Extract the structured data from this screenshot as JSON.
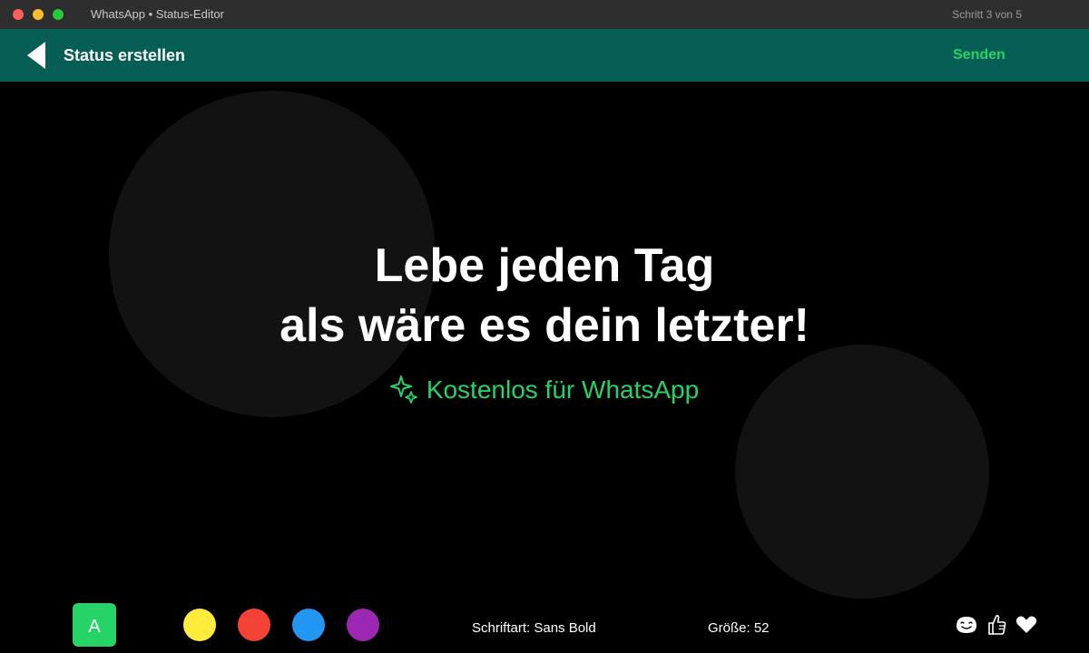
{
  "window": {
    "title": "WhatsApp • Status-Editor",
    "step": "Schritt 3 von 5"
  },
  "header": {
    "back_icon": "back-arrow-icon",
    "title": "Status erstellen",
    "send_label": "Senden"
  },
  "status": {
    "lines": [
      "Lebe jeden Tag",
      "als wäre es dein letzter!"
    ],
    "badge": "Kostenlos für WhatsApp",
    "badge_icon": "sparkle-icon"
  },
  "toolbar": {
    "font_button": "A",
    "swatches": [
      "#ffeb3b",
      "#f44336",
      "#2196f3",
      "#9c27b0"
    ],
    "font_label": "Schriftart: Sans Bold",
    "size_label": "Größe: 52",
    "icons": [
      "smiley-icon",
      "thumbs-up-icon",
      "heart-icon"
    ]
  },
  "colors": {
    "header": "#075e54",
    "accent": "#25d366",
    "background": "#000000"
  }
}
